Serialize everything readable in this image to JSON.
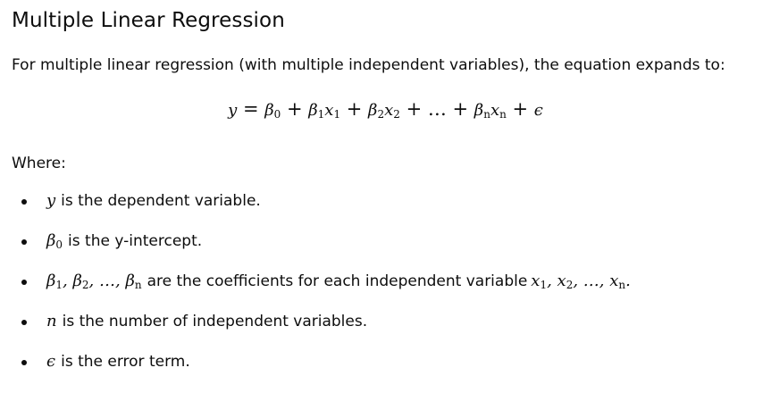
{
  "heading": "Multiple Linear Regression",
  "intro": "For multiple linear regression (with multiple independent variables), the equation expands to:",
  "equation": {
    "y": "y",
    "eq": " = ",
    "b0": "β",
    "b0_sub": "0",
    "plus1": " + ",
    "b1": "β",
    "b1_sub": "1",
    "x1": "x",
    "x1_sub": "1",
    "plus2": " + ",
    "b2": "β",
    "b2_sub": "2",
    "x2": "x",
    "x2_sub": "2",
    "plus3": " + … + ",
    "bn": "β",
    "bn_sub": "n",
    "xn": "x",
    "xn_sub": "n",
    "plus4": " + ",
    "eps": "ϵ"
  },
  "where_label": "Where:",
  "bullets": {
    "item1": {
      "math": "y",
      "text": "is the dependent variable."
    },
    "item2": {
      "math": "β",
      "math_sub": "0",
      "text": "is the y-intercept."
    },
    "item3": {
      "math_b": "β",
      "math_b1": "1",
      "math_b2": "2",
      "math_bn": "n",
      "sep": ", ",
      "ellipsis": "…",
      "text": "are the coefficients for each independent variable",
      "math_x": "x",
      "math_x1": "1",
      "math_x2": "2",
      "math_xn": "n",
      "period": "."
    },
    "item4": {
      "math": "n",
      "text": "is the number of independent variables."
    },
    "item5": {
      "math": "ϵ",
      "text": "is the error term."
    }
  }
}
